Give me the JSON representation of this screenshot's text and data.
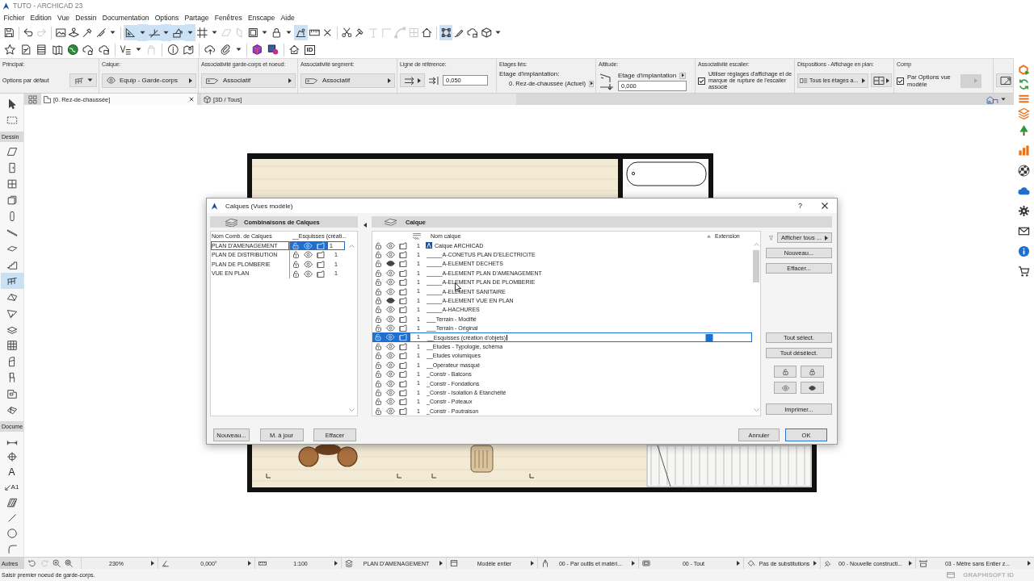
{
  "window": {
    "title": "TUTO - ARCHICAD 23"
  },
  "menu": [
    "Fichier",
    "Edition",
    "Vue",
    "Dessin",
    "Documentation",
    "Options",
    "Partage",
    "Fenêtres",
    "Enscape",
    "Aide"
  ],
  "toolbar": {
    "row_1": [
      [
        {
          "kind": "save",
          "on": false,
          "disabled": false
        }
      ],
      [
        {
          "kind": "undo",
          "on": false,
          "disabled": false
        },
        {
          "kind": "redo",
          "on": false,
          "disabled": true
        }
      ],
      [
        {
          "kind": "picture",
          "on": false,
          "disabled": false
        },
        {
          "kind": "layer_pin",
          "on": false,
          "disabled": false
        },
        {
          "kind": "eyedropper",
          "on": false,
          "disabled": false
        },
        {
          "kind": "syringe",
          "on": false,
          "disabled": false
        },
        {
          "kind": "caret",
          "on": false,
          "disabled": false
        }
      ],
      [
        {
          "kind": "set_square",
          "on": true,
          "disabled": false
        },
        {
          "kind": "caret",
          "on": true,
          "disabled": false
        },
        {
          "kind": "guide",
          "on": true,
          "disabled": false
        },
        {
          "kind": "caret",
          "on": true,
          "disabled": false
        },
        {
          "kind": "snap_point",
          "on": true,
          "disabled": false
        },
        {
          "kind": "caret",
          "on": true,
          "disabled": false
        },
        {
          "kind": "grid",
          "on": false,
          "disabled": false
        },
        {
          "kind": "caret",
          "on": false,
          "disabled": false
        },
        {
          "kind": "slanted_plane",
          "on": false,
          "disabled": true
        },
        {
          "kind": "vertical_plane",
          "on": false,
          "disabled": true
        },
        {
          "kind": "frame",
          "on": false,
          "disabled": false
        },
        {
          "kind": "caret",
          "on": false,
          "disabled": false
        },
        {
          "kind": "padlock",
          "on": false,
          "disabled": false
        },
        {
          "kind": "caret",
          "on": false,
          "disabled": false
        },
        {
          "kind": "gravity",
          "on": true,
          "disabled": false
        },
        {
          "kind": "ruler",
          "on": false,
          "disabled": false
        },
        {
          "kind": "x_mark",
          "on": false,
          "disabled": false
        }
      ],
      [
        {
          "kind": "scissors",
          "on": false,
          "disabled": false
        },
        {
          "kind": "hammer",
          "on": false,
          "disabled": false
        },
        {
          "kind": "t_shape",
          "on": false,
          "disabled": true
        },
        {
          "kind": "corner",
          "on": false,
          "disabled": true
        },
        {
          "kind": "arc",
          "on": false,
          "disabled": true
        },
        {
          "kind": "split_square",
          "on": false,
          "disabled": true
        },
        {
          "kind": "house",
          "on": false,
          "disabled": false
        }
      ],
      [
        {
          "kind": "nodes",
          "on": true,
          "disabled": false
        },
        {
          "kind": "brush",
          "on": false,
          "disabled": false
        },
        {
          "kind": "cloud_lock",
          "on": false,
          "disabled": false
        },
        {
          "kind": "cube",
          "on": false,
          "disabled": false
        },
        {
          "kind": "caret",
          "on": false,
          "disabled": false
        }
      ]
    ],
    "row_2": [
      [
        {
          "kind": "star",
          "on": false,
          "disabled": false
        },
        {
          "kind": "document",
          "on": false,
          "disabled": false
        },
        {
          "kind": "stack",
          "on": false,
          "disabled": false
        },
        {
          "kind": "map",
          "on": false,
          "disabled": false
        },
        {
          "kind": "globe",
          "on": false,
          "disabled": false
        },
        {
          "kind": "cloud_house",
          "on": false,
          "disabled": false
        },
        {
          "kind": "cloud_box",
          "on": false,
          "disabled": false
        }
      ],
      [
        {
          "kind": "check_lines",
          "on": false,
          "disabled": false
        },
        {
          "kind": "caret",
          "on": false,
          "disabled": false
        },
        {
          "kind": "box",
          "on": false,
          "disabled": true
        }
      ],
      [
        {
          "kind": "info",
          "on": false,
          "disabled": false
        },
        {
          "kind": "map_pin",
          "on": false,
          "disabled": false
        }
      ],
      [
        {
          "kind": "cloud_upload",
          "on": false,
          "disabled": false
        },
        {
          "kind": "paperclip",
          "on": false,
          "disabled": false
        },
        {
          "kind": "caret",
          "on": false,
          "disabled": false
        }
      ],
      [
        {
          "kind": "colored_cube",
          "on": false,
          "disabled": false
        },
        {
          "kind": "square_circle",
          "on": false,
          "disabled": false
        }
      ],
      [
        {
          "kind": "house_check",
          "on": false,
          "disabled": false
        },
        {
          "kind": "text",
          "label": "ID",
          "on": false,
          "disabled": false
        }
      ]
    ]
  },
  "info_box": [
    {
      "kind": "preset",
      "label": "Principal:",
      "value": "Options par défaut"
    },
    {
      "kind": "layer",
      "label": "Calque:",
      "value": "Equip - Garde-corps"
    },
    {
      "kind": "associativity",
      "label": "Associativité garde-corps et noeud:",
      "value": "Associatif"
    },
    {
      "kind": "associativity",
      "label": "Associativité segment:",
      "value": "Associatif"
    },
    {
      "kind": "reference",
      "label": "Ligne de référence:",
      "value": "0,050"
    },
    {
      "kind": "stories",
      "label": "Etages liés:",
      "caption": "Etage d'implantation:",
      "value": "0. Rez-de-chaussée (Actuel)"
    },
    {
      "kind": "altitude",
      "label": "Altitude:",
      "caption": "Etage d'implantation",
      "value": "0,000"
    },
    {
      "kind": "option",
      "label": "Associativité escalier:",
      "text": "Utiliser réglages d'affichage et de marque de rupture de l'escalier associé",
      "checked": true
    },
    {
      "kind": "display",
      "label": "Dispositions - Affichage en plan:",
      "value": "Tous les étages a..."
    },
    {
      "kind": "option_menu",
      "label": "Comp",
      "text": "Par Options vue modèle",
      "checked": true,
      "menu_disabled": true
    },
    {
      "kind": "panel"
    }
  ],
  "tabs": [
    {
      "kind": "plan",
      "label": "[0. Rez-de-chaussée]",
      "selected": true
    },
    {
      "kind": "model",
      "label": "[3D / Tous]",
      "selected": false
    }
  ],
  "toolbox": {
    "tools": [
      {
        "kind": "pointer",
        "selected": false
      },
      {
        "kind": "marquee",
        "selected": false
      }
    ],
    "groups": [
      {
        "label": "Dessin",
        "tools": [
          {
            "kind": "wall",
            "selected": false
          },
          {
            "kind": "door",
            "selected": false
          },
          {
            "kind": "window",
            "selected": false
          },
          {
            "kind": "window_box",
            "selected": false
          },
          {
            "kind": "column",
            "selected": false
          },
          {
            "kind": "beam",
            "selected": false
          },
          {
            "kind": "slab",
            "selected": false
          },
          {
            "kind": "stairs",
            "selected": false
          },
          {
            "kind": "railing",
            "selected": true
          },
          {
            "kind": "roof",
            "selected": false
          },
          {
            "kind": "shell",
            "selected": false
          },
          {
            "kind": "layered_plane",
            "selected": false
          },
          {
            "kind": "curtain",
            "selected": false
          },
          {
            "kind": "morph",
            "selected": false
          },
          {
            "kind": "chair",
            "selected": false
          },
          {
            "kind": "zone",
            "selected": false
          },
          {
            "kind": "mesh",
            "selected": false
          }
        ]
      },
      {
        "label": "Docume",
        "tools": [
          {
            "kind": "dimension",
            "selected": false
          },
          {
            "kind": "crosshair",
            "selected": false
          },
          {
            "kind": "text",
            "label": "A",
            "selected": false
          },
          {
            "kind": "label",
            "label": "A1",
            "selected": false
          },
          {
            "kind": "hatch",
            "selected": false
          },
          {
            "kind": "line",
            "selected": false
          },
          {
            "kind": "circle",
            "selected": false
          },
          {
            "kind": "arc",
            "selected": false
          }
        ]
      }
    ]
  },
  "side_toolbar": [
    {
      "kind": "logo"
    },
    {
      "kind": "refresh"
    },
    {
      "kind": "lines"
    },
    {
      "kind": "stack"
    },
    {
      "kind": "tree"
    },
    {
      "kind": "bars"
    },
    {
      "kind": "checker"
    },
    {
      "kind": "cloud"
    },
    {
      "kind": "settings"
    },
    {
      "kind": "mail"
    },
    {
      "kind": "info"
    },
    {
      "kind": "cart"
    }
  ],
  "dialog": {
    "title": "Calques (Vues modèle)",
    "help": "?",
    "combinations": {
      "header": "Combinaisons de Calques",
      "columns": [
        "Nom Comb. de Calques",
        "__Esquisses (créati..."
      ],
      "rows": [
        {
          "name": "PLAN D'AMENAGEMENT",
          "selected": true,
          "locked": false,
          "visible": true,
          "pen": "1"
        },
        {
          "name": "PLAN DE DISTRIBUTION",
          "selected": false,
          "locked": false,
          "visible": true,
          "pen": "1"
        },
        {
          "name": "PLAN DE PLOMBERIE",
          "selected": false,
          "locked": false,
          "visible": true,
          "pen": "1"
        },
        {
          "name": "VUE EN PLAN",
          "selected": false,
          "locked": false,
          "visible": true,
          "pen": "1"
        }
      ],
      "buttons": [
        "Nouveau...",
        "M. à jour",
        "Effacer"
      ]
    },
    "layers": {
      "header": "Calque",
      "columns": {
        "name": "Nom calque",
        "extension": "Extension"
      },
      "rows": [
        {
          "kind": "system",
          "name": "Calque ARCHICAD",
          "selected": false,
          "locked": false,
          "visible": true,
          "pen": "1"
        },
        {
          "kind": "layer",
          "name": "_____A-CONETUS PLAN D'ELECTRICITE",
          "selected": false,
          "locked": false,
          "visible": true,
          "pen": "1"
        },
        {
          "kind": "layer",
          "name": "_____A-ELEMENT DECHETS",
          "selected": false,
          "locked": false,
          "visible": false,
          "pen": "1"
        },
        {
          "kind": "layer",
          "name": "_____A-ELEMENT PLAN D'AMENAGEMENT",
          "selected": false,
          "locked": false,
          "visible": true,
          "pen": "1"
        },
        {
          "kind": "layer",
          "name": "_____A-ELEMENT PLAN DE PLOMBERIE",
          "selected": false,
          "locked": false,
          "visible": true,
          "pen": "1"
        },
        {
          "kind": "layer",
          "name": "_____A-ELEMENT SANITAIRE",
          "selected": false,
          "locked": false,
          "visible": true,
          "pen": "1"
        },
        {
          "kind": "layer",
          "name": "_____A-ELEMENT VUE EN PLAN",
          "selected": false,
          "locked": true,
          "visible": false,
          "pen": "1"
        },
        {
          "kind": "layer",
          "name": "_____A-HACHURES",
          "selected": false,
          "locked": false,
          "visible": true,
          "pen": "1"
        },
        {
          "kind": "layer",
          "name": "___Terrain - Modifié",
          "selected": false,
          "locked": false,
          "visible": true,
          "pen": "1"
        },
        {
          "kind": "layer",
          "name": "___Terrain - Original",
          "selected": false,
          "locked": false,
          "visible": true,
          "pen": "1"
        },
        {
          "kind": "layer",
          "name": "__Esquisses (création d'objets)",
          "selected": true,
          "locked": false,
          "visible": true,
          "pen": "1"
        },
        {
          "kind": "layer",
          "name": "__Etudes - Typologie, schéma",
          "selected": false,
          "locked": false,
          "visible": true,
          "pen": "1"
        },
        {
          "kind": "layer",
          "name": "__Etudes volumiques",
          "selected": false,
          "locked": false,
          "visible": true,
          "pen": "1"
        },
        {
          "kind": "layer",
          "name": "__Opérateur masqué",
          "selected": false,
          "locked": false,
          "visible": true,
          "pen": "1"
        },
        {
          "kind": "layer",
          "name": "_Constr - Balcons",
          "selected": false,
          "locked": false,
          "visible": true,
          "pen": "1"
        },
        {
          "kind": "layer",
          "name": "_Constr - Fondations",
          "selected": false,
          "locked": false,
          "visible": true,
          "pen": "1"
        },
        {
          "kind": "layer",
          "name": "_Constr - Isolation & Etanchéité",
          "selected": false,
          "locked": false,
          "visible": true,
          "pen": "1"
        },
        {
          "kind": "layer",
          "name": "_Constr - Poteaux",
          "selected": false,
          "locked": false,
          "visible": true,
          "pen": "1"
        },
        {
          "kind": "layer",
          "name": "_Constr - Poutraison",
          "selected": false,
          "locked": false,
          "visible": true,
          "pen": "1"
        }
      ],
      "filter": "Afficher tous ...",
      "buttons": [
        "Nouveau...",
        "Effacer..."
      ],
      "selection_buttons": [
        "Tout sélect.",
        "Tout désélect."
      ],
      "print": "Imprimer..."
    },
    "actions": [
      {
        "label": "Annuler",
        "default": false
      },
      {
        "label": "OK",
        "default": true
      }
    ]
  },
  "status_bar": {
    "palette": "Autres",
    "items": [
      {
        "kind": "zoom",
        "value": "230%"
      },
      {
        "kind": "angle",
        "value": "0,000°"
      },
      {
        "kind": "scale",
        "value": "1:100"
      },
      {
        "kind": "layers",
        "value": "PLAN D'AMENAGEMENT"
      },
      {
        "kind": "model",
        "value": "Modèle entier"
      },
      {
        "kind": "pens",
        "value": "00 - Par outils et matéri..."
      },
      {
        "kind": "options",
        "value": "00 - Tout"
      },
      {
        "kind": "override",
        "value": "Pas de substitutions"
      },
      {
        "kind": "renovation",
        "value": "00 - Nouvelle constructi..."
      },
      {
        "kind": "dimension",
        "value": "03 - Mètre sans Entier z..."
      }
    ]
  },
  "message_bar": {
    "text": "Saisir premier noeud de garde-corps.",
    "account": "GRAPHISOFT ID"
  }
}
